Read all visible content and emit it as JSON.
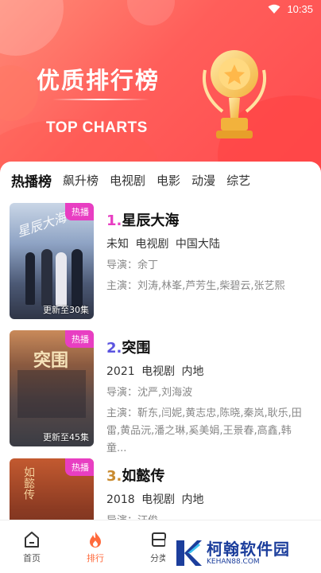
{
  "status_bar": {
    "time": "10:35",
    "wifi_icon": "wifi-icon",
    "battery_icon": "battery-icon"
  },
  "banner": {
    "title": "优质排行榜",
    "subtitle": "TOP CHARTS",
    "trophy_icon": "trophy-icon"
  },
  "tabs": [
    {
      "label": "热播榜",
      "active": true
    },
    {
      "label": "飙升榜"
    },
    {
      "label": "电视剧"
    },
    {
      "label": "电影"
    },
    {
      "label": "动漫"
    },
    {
      "label": "综艺"
    }
  ],
  "items": [
    {
      "rank": "1.",
      "title": "星辰大海",
      "badge": "热播",
      "update": "更新至30集",
      "meta": "未知  电视剧  中国大陆",
      "director": "导演：余丁",
      "cast": "主演：刘涛,林峯,芦芳生,柴碧云,张艺熙",
      "poster_text": "星辰大海"
    },
    {
      "rank": "2.",
      "title": "突围",
      "badge": "热播",
      "update": "更新至45集",
      "meta": "2021  电视剧  内地",
      "director": "导演：沈严,刘海波",
      "cast": "主演：靳东,闫妮,黄志忠,陈晓,秦岚,耿乐,田雷,黄品沅,潘之琳,奚美娟,王景春,高鑫,韩童...",
      "poster_text": "突围"
    },
    {
      "rank": "3.",
      "title": "如懿传",
      "badge": "热播",
      "update": "",
      "meta": "2018  电视剧  内地",
      "director": "导演：汪俊",
      "cast": "",
      "poster_text": "如懿传"
    }
  ],
  "bottom_nav": [
    {
      "label": "首页",
      "icon": "home-icon"
    },
    {
      "label": "排行",
      "icon": "flame-icon",
      "active": true
    },
    {
      "label": "分类",
      "icon": "category-icon"
    }
  ],
  "watermark": {
    "name": "柯翰软件园",
    "url": "KEHAN88.COM"
  },
  "colors": {
    "accent": "#ff6a3c",
    "badge": "#e83ec2",
    "banner": "#ff5e5a"
  }
}
